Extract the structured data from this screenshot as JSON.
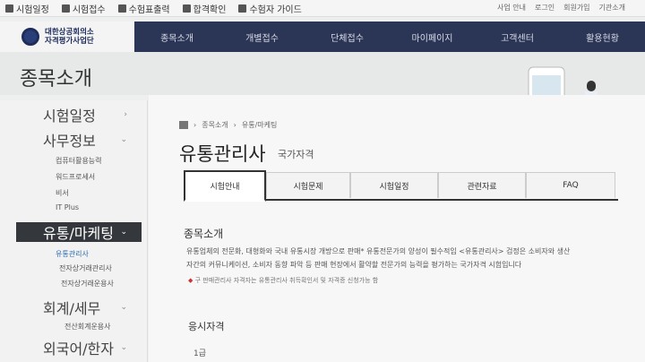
{
  "topbar": {
    "links": [
      "시험일정",
      "시험접수",
      "수험표출력",
      "합격확인",
      "수험자 가이드"
    ],
    "util": [
      "사업 안내",
      "로그인",
      "회원가입",
      "기관소개"
    ]
  },
  "logo": {
    "line1": "대한상공회의소",
    "line2": "자격평가사업단"
  },
  "nav": [
    "종목소개",
    "개별접수",
    "단체접수",
    "마이페이지",
    "고객센터",
    "활용현황"
  ],
  "page_title": "종목소개",
  "sidebar": {
    "items": [
      {
        "label": "시험일정"
      },
      {
        "label": "사무정보"
      },
      {
        "label": "유통/마케팅"
      },
      {
        "label": "회계/세무"
      },
      {
        "label": "외국어/한자"
      }
    ],
    "sub_office": [
      "컴퓨터활용능력",
      "워드프로세서",
      "비서",
      "IT Plus"
    ],
    "sub_retail": [
      "유통관리사",
      "전자상거래관리사",
      "전자상거래운용사"
    ],
    "sub_account": [
      "전산회계운용사"
    ]
  },
  "breadcrumb": [
    "종목소개",
    "유통/마케팅"
  ],
  "title": "유통관리사",
  "badge": "국가자격",
  "tabs": [
    "시험안내",
    "시험문제",
    "시험일정",
    "관련자료",
    "FAQ"
  ],
  "section1": {
    "heading": "종목소개",
    "line1": "유통업체의 전문화, 대형화와 국내 유통시장 개방으로 판매* 유통전문가의 양성이 필수적임 <유통관리사> 검정은 소비자와 생산",
    "line2": "자간의 커뮤니케이션, 소비자 동향 파악 등 판매 현장에서 활약할 전문가의 능력을 평가하는 국가자격 시험입니다",
    "note": "구 판매관리사 자격자는 유통관리사 취득확인서 및 자격증 신청가능 함"
  },
  "section2": {
    "heading": "응시자격",
    "grade": "1급"
  }
}
